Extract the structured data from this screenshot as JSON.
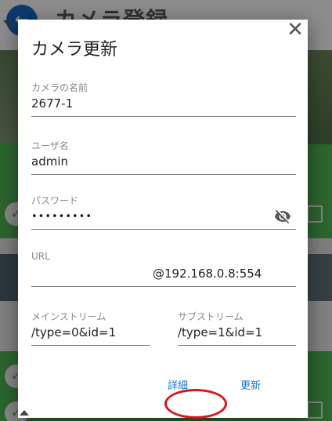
{
  "background": {
    "title": "カメラ登録"
  },
  "dialog": {
    "title": "カメラ更新",
    "fields": {
      "camera_name": {
        "label": "カメラの名前",
        "value": "2677-1"
      },
      "username": {
        "label": "ユーザ名",
        "value": "admin"
      },
      "password": {
        "label": "パスワード",
        "value": "•••••••••"
      },
      "url": {
        "label": "URL",
        "value": "@192.168.0.8:554"
      },
      "main_stream": {
        "label": "メインストリーム",
        "value": "/type=0&id=1"
      },
      "sub_stream": {
        "label": "サブストリーム",
        "value": "/type=1&id=1"
      }
    },
    "buttons": {
      "detail": "詳細",
      "update": "更新"
    }
  },
  "colors": {
    "accent": "#1976d2",
    "annotation": "#d9141c",
    "list_green": "#4caf50",
    "back_button": "#1565c0"
  },
  "icons": [
    "back-arrow-icon",
    "close-icon",
    "visibility-off-icon",
    "check-icon",
    "trash-icon"
  ]
}
